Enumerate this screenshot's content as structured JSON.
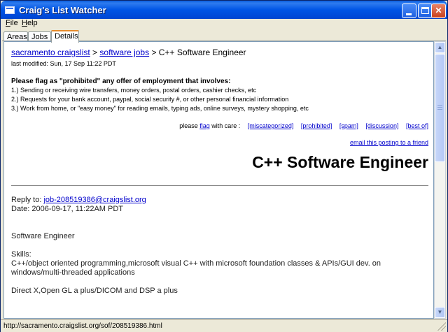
{
  "window": {
    "title": "Craig's List Watcher",
    "min_glyph": "_",
    "max_glyph": "□",
    "close_glyph": "✕"
  },
  "menu": {
    "file_u": "F",
    "file_rest": "ile",
    "help_u": "H",
    "help_rest": "elp"
  },
  "tabs": [
    {
      "label": "Areas"
    },
    {
      "label": "Jobs"
    },
    {
      "label": "Details"
    }
  ],
  "posting": {
    "crumb_site": "sacramento craigslist",
    "crumb_sep1": " > ",
    "crumb_section": "software jobs",
    "crumb_sep2": " > ",
    "crumb_title": "C++ Software Engineer",
    "last_modified": "last modified: Sun, 17 Sep 11:22 PDT",
    "warning_title": "Please flag as \"prohibited\" any offer of employment that involves:",
    "warning_items": [
      "1.) Sending or receiving wire transfers, money orders, postal orders, cashier checks, etc",
      "2.) Requests for your bank account, paypal, social security #, or other personal financial information",
      "3.) Work from home, or \"easy money\" for reading emails, typing ads, online surveys, mystery shopping, etc"
    ],
    "flag_prefix": "please ",
    "flag_link": "flag",
    "flag_suffix": " with care :",
    "flag_options": [
      "[miscategorized]",
      "[prohibited]",
      "[spam]",
      "[discussion]",
      "[best of]"
    ],
    "email_friend": "email this posting to a friend",
    "heading": "C++ Software Engineer",
    "reply_label": "Reply to: ",
    "reply_email": "job-208519386@craigslist.org",
    "date_line": "Date: 2006-09-17, 11:22AM PDT",
    "body_title": "Software Engineer",
    "skills_label": "Skills:",
    "skills_text": "C++/object oriented programming,microsoft visual C++ with microsoft foundation classes & APIs/GUI dev. on windows/multi-threaded applications",
    "extras_text": "Direct X,Open GL a plus/DICOM and DSP a plus"
  },
  "status": {
    "url": "http://sacramento.craigslist.org/sof/208519386.html"
  },
  "colors": {
    "titlebar": "#0055e5",
    "link": "#0000cc",
    "active_tab_accent": "#e68b2c"
  }
}
